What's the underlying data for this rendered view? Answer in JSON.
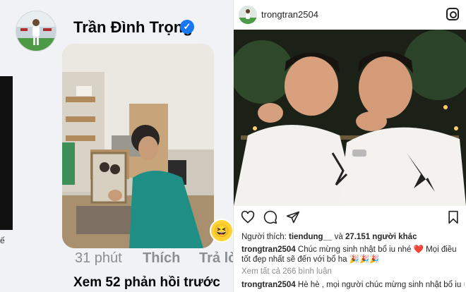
{
  "facebook": {
    "left_edge_text": "ế",
    "name": "Trần Đình Trọng",
    "verified_icon": "verified-check-icon",
    "time": "31 phút",
    "like_label": "Thích",
    "reply_label": "Trả lời",
    "reaction_icon": "laughing-emoji-icon",
    "view_more": "Xem 52 phản hồi trước"
  },
  "instagram": {
    "username": "trongtran2504",
    "likes_prefix": "Người thích:",
    "liker": "tiendung__",
    "likes_conj": "và",
    "others": "27.151 người khác",
    "caption_user": "trongtran2504",
    "caption_text": "Chúc mừng sinh nhật bổ iu nhé ❤️ Mọi điều tốt đẹp nhất sẽ đến với bổ ha 🎉🎉🎉",
    "view_comments": "Xem tất cả 266 bình luận",
    "comment_user": "trongtran2504",
    "comment_text": "Hè hè , mọi người chúc mừng sinh nhật bổ iu 😁😁"
  },
  "colors": {
    "fb_blue": "#1877f2",
    "fb_gray_text": "#8a8d91",
    "ig_text": "#262626",
    "ig_gray": "#8e8e8e",
    "heart_red": "#ed4956"
  }
}
